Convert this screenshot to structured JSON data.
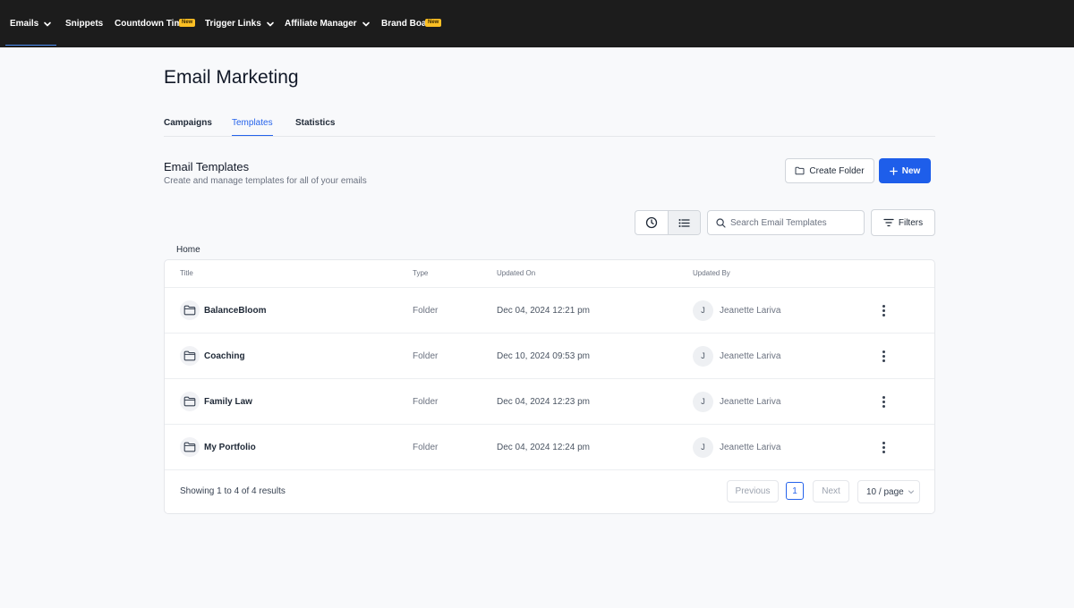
{
  "nav": {
    "items": [
      {
        "label": "Emails",
        "badge": "",
        "has_chevron": true
      },
      {
        "label": "Snippets",
        "badge": "",
        "has_chevron": false
      },
      {
        "label": "Countdown Timers",
        "badge": "New",
        "has_chevron": false
      },
      {
        "label": "Trigger Links",
        "badge": "",
        "has_chevron": true
      },
      {
        "label": "Affiliate Manager",
        "badge": "",
        "has_chevron": true
      },
      {
        "label": "Brand Boards",
        "badge": "New",
        "has_chevron": false
      }
    ]
  },
  "page": {
    "title": "Email Marketing",
    "tabs": [
      {
        "label": "Campaigns"
      },
      {
        "label": "Templates"
      },
      {
        "label": "Statistics"
      }
    ]
  },
  "section": {
    "title": "Email Templates",
    "subtitle": "Create and manage templates for all of your emails",
    "create_folder_label": "Create Folder",
    "new_label": "New"
  },
  "toolbar": {
    "search_placeholder": "Search Email Templates",
    "filters_label": "Filters"
  },
  "breadcrumb": "Home",
  "table": {
    "columns": {
      "title": "Title",
      "type": "Type",
      "updated_on": "Updated On",
      "updated_by": "Updated By"
    },
    "rows": [
      {
        "title": "BalanceBloom",
        "type": "Folder",
        "updated_on": "Dec 04, 2024 12:21 pm",
        "initial": "J",
        "updated_by": "Jeanette Lariva"
      },
      {
        "title": "Coaching",
        "type": "Folder",
        "updated_on": "Dec 10, 2024 09:53 pm",
        "initial": "J",
        "updated_by": "Jeanette Lariva"
      },
      {
        "title": "Family Law",
        "type": "Folder",
        "updated_on": "Dec 04, 2024 12:23 pm",
        "initial": "J",
        "updated_by": "Jeanette Lariva"
      },
      {
        "title": "My Portfolio",
        "type": "Folder",
        "updated_on": "Dec 04, 2024 12:24 pm",
        "initial": "J",
        "updated_by": "Jeanette Lariva"
      }
    ]
  },
  "pagination": {
    "summary": "Showing 1 to 4 of 4 results",
    "previous": "Previous",
    "page": "1",
    "next": "Next",
    "per_page": "10 / page"
  },
  "colors": {
    "accent": "#1e5eea",
    "nav_bg": "#1c1c1c",
    "badge": "#fbbf24"
  }
}
